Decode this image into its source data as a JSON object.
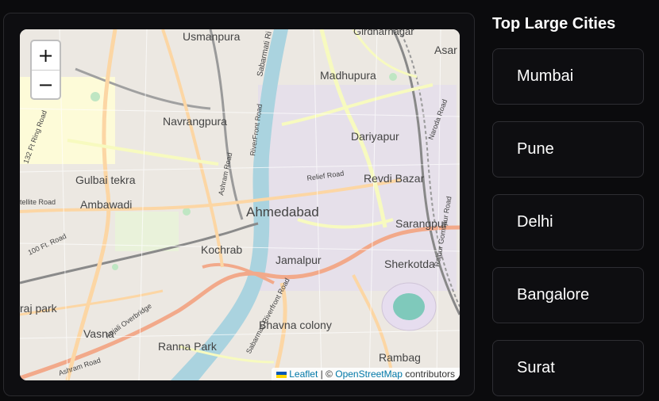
{
  "map": {
    "zoom_in": "+",
    "zoom_out": "−",
    "labels": {
      "center": "Ahmedabad",
      "usmanpura": "Usmanpura",
      "navrangpura": "Navrangpura",
      "gulbai": "Gulbai tekra",
      "ambawadi": "Ambawadi",
      "kochrab": "Kochrab",
      "jamalpur": "Jamalpur",
      "madhupura": "Madhupura",
      "dariyapur": "Dariyapur",
      "revdi": "Revdi Bazar",
      "sarangpur": "Sarangpur",
      "sherkotda": "Sherkotda",
      "bhavna": "Bhavna colony",
      "ranna": "Ranna Park",
      "vasna": "Vasna",
      "paldi": "raj park",
      "rambag": "Rambag",
      "girdhar": "Girdharnagar",
      "asarva": "Asar",
      "ring_road": "132 Ft Ring Road",
      "satellite": "tellite Road",
      "ft100": "100 Ft. Road",
      "ashram": "Ashram Road",
      "ellis": "Anjali Overbridge",
      "riverfront": "RiverFront Road",
      "riverfront2": "Sabarmati Riverfront Road",
      "relief": "Relief Road",
      "sabarmati": "Sabarmati Ri",
      "ashram2": "Ashram Road",
      "naroda": "Naroda Road",
      "rajpur": "Rajpur Gomtipur Road"
    },
    "attribution": {
      "leaflet": "Leaflet",
      "separator": " | © ",
      "osm": "OpenStreetMap",
      "suffix": " contributors"
    }
  },
  "sidebar": {
    "title": "Top Large Cities",
    "cities": [
      "Mumbai",
      "Pune",
      "Delhi",
      "Bangalore",
      "Surat"
    ]
  }
}
